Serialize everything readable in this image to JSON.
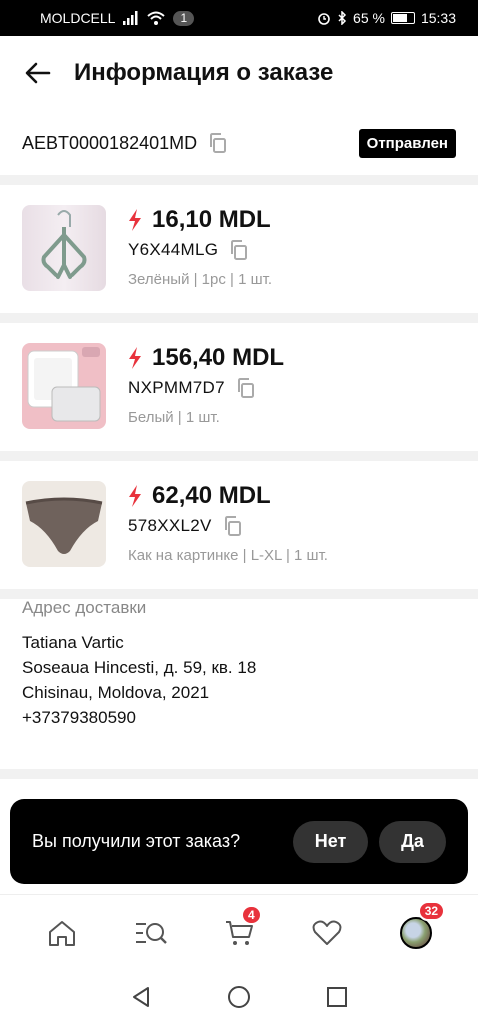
{
  "statusbar": {
    "carrier": "MOLDCELL",
    "sim_badge": "1",
    "battery": "65 %",
    "time": "15:33"
  },
  "header": {
    "title": "Информация о заказе"
  },
  "order": {
    "id": "AEBT0000182401MD",
    "status": "Отправлен"
  },
  "items": [
    {
      "price": "16,10 MDL",
      "sku": "Y6X44MLG",
      "variant": "Зелёный | 1рс | 1 шт."
    },
    {
      "price": "156,40 MDL",
      "sku": "NXPMM7D7",
      "variant": "Белый | 1 шт."
    },
    {
      "price": "62,40 MDL",
      "sku": "578XXL2V",
      "variant": "Как на картинке | L-XL | 1 шт."
    }
  ],
  "address": {
    "label": "Адрес доставки",
    "name": "Tatiana Vartic",
    "street": "Soseaua Hincesti, д. 59, кв. 18",
    "city": "Chisinau, Moldova, 2021",
    "phone": "+37379380590"
  },
  "confirm": {
    "question": "Вы получили этот заказ?",
    "no_label": "Нет",
    "yes_label": "Да"
  },
  "tabbar": {
    "cart_count": "4",
    "profile_count": "32"
  },
  "colors": {
    "accent": "#e8323c",
    "badge_bg": "#000000"
  }
}
